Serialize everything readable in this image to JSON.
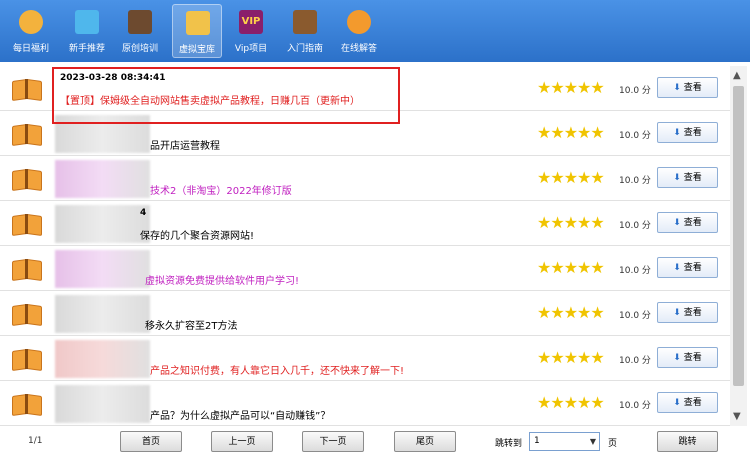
{
  "toolbar": {
    "items": [
      {
        "label": "每日福利",
        "color": "#f3b23d"
      },
      {
        "label": "新手推荐",
        "color": "#4fb7ec"
      },
      {
        "label": "原创培训",
        "color": "#6d4a2f"
      },
      {
        "label": "虚拟宝库",
        "color": "#f1c24a"
      },
      {
        "label": "Vip项目",
        "color": "#8a1f6b"
      },
      {
        "label": "入门指南",
        "color": "#8a5a2e"
      },
      {
        "label": "在线解答",
        "color": "#f39a2d"
      }
    ],
    "vip_badge": "VIP"
  },
  "list": {
    "rows": [
      {
        "date": "2023-03-28 08:34:41",
        "title": "【置顶】保姆级全自动网站售卖虚拟产品教程，日赚几百（更新中）",
        "color": "#e02020",
        "stars": "★★★★★",
        "score": "10.0 分",
        "btn": "查看"
      },
      {
        "date": "",
        "title": "品开店运营教程",
        "color": "#000000",
        "stars": "★★★★★",
        "score": "10.0 分",
        "btn": "查看"
      },
      {
        "date": "",
        "title": "技术2（非淘宝）2022年修订版",
        "color": "#c020c0",
        "stars": "★★★★★",
        "score": "10.0 分",
        "btn": "查看"
      },
      {
        "date": "4",
        "title": "保存的几个聚合资源网站!",
        "color": "#000000",
        "stars": "★★★★★",
        "score": "10.0 分",
        "btn": "查看"
      },
      {
        "date": "",
        "title": "虚拟资源免费提供给软件用户学习!",
        "color": "#c020c0",
        "stars": "★★★★★",
        "score": "10.0 分",
        "btn": "查看"
      },
      {
        "date": "",
        "title": "移永久扩容至2T方法",
        "color": "#000000",
        "stars": "★★★★★",
        "score": "10.0 分",
        "btn": "查看"
      },
      {
        "date": "",
        "title": "产品之知识付费，有人靠它日入几千，还不快来了解一下!",
        "color": "#e02020",
        "stars": "★★★★★",
        "score": "10.0 分",
        "btn": "查看"
      },
      {
        "date": "",
        "title": "产品？为什么虚拟产品可以“自动赚钱”？",
        "color": "#000000",
        "stars": "★★★★★",
        "score": "10.0 分",
        "btn": "查看"
      }
    ]
  },
  "footer": {
    "page_info": "1/1",
    "first": "首页",
    "prev": "上一页",
    "next": "下一页",
    "last": "尾页",
    "jump_label": "跳转到",
    "page_value": "1",
    "page_unit": "页",
    "jump_btn": "跳转"
  }
}
